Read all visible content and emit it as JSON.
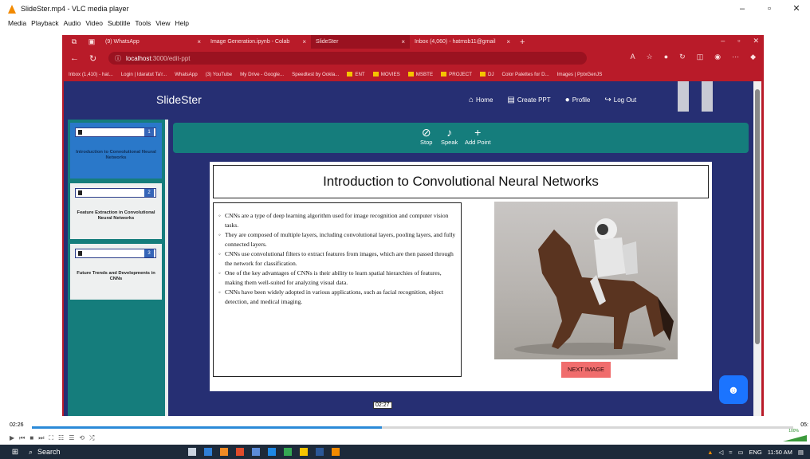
{
  "vlc": {
    "title": "SlideSter.mp4 - VLC media player",
    "menu": [
      "Media",
      "Playback",
      "Audio",
      "Video",
      "Subtitle",
      "Tools",
      "View",
      "Help"
    ],
    "time_elapsed": "02:26",
    "time_total": "05:",
    "progress": 0.46,
    "volume": "100%"
  },
  "browser": {
    "tabs": [
      {
        "label": "(9) WhatsApp"
      },
      {
        "label": "Image Generation.ipynb - Colab"
      },
      {
        "label": "SlideSter"
      },
      {
        "label": "Inbox (4,060) - hatmsb11@gmail"
      }
    ],
    "url_host": "localhost",
    "url_path": ":3000/edit-ppt",
    "bookmarks": [
      "Inbox (1,410) - hat...",
      "Login | Idaratut Ta'r...",
      "WhatsApp",
      "(3) YouTube",
      "My Drive - Google...",
      "Speedtest by Ookla...",
      "ENT",
      "MOVIES",
      "MSBTE",
      "PROJECT",
      "DJ",
      "Color Palettes for D...",
      "Images | PptxGenJS"
    ]
  },
  "app": {
    "brand": "SlideSter",
    "nav": {
      "home": "Home",
      "create": "Create PPT",
      "profile": "Profile",
      "logout": "Log Out"
    },
    "toolbar": {
      "stop": "Stop",
      "speak": "Speak",
      "add": "Add Point"
    },
    "slides": [
      {
        "num": "1",
        "title": "Introduction to Convolutional Neural Networks"
      },
      {
        "num": "2",
        "title": "Feature Extraction in Convolutional Neural Networks"
      },
      {
        "num": "3",
        "title": "Future Trends and Developments in CNNs"
      }
    ],
    "current_slide": {
      "title": "Introduction to Convolutional Neural Networks",
      "points": [
        "CNNs are a type of deep learning algorithm used for image recognition and computer vision tasks.",
        "They are composed of multiple layers, including convolutional layers, pooling layers, and fully connected layers.",
        "CNNs use convolutional filters to extract features from images, which are then passed through the network for classification.",
        "One of the key advantages of CNNs is their ability to learn spatial hierarchies of features, making them well-suited for analyzing visual data.",
        "CNNs have been widely adopted in various applications, such as facial recognition, object detection, and medical imaging."
      ],
      "next_image": "NEXT IMAGE"
    },
    "time_overlay": "02:27"
  },
  "taskbar": {
    "search": "Search",
    "lang": "ENG",
    "clock": "11:50 AM"
  }
}
